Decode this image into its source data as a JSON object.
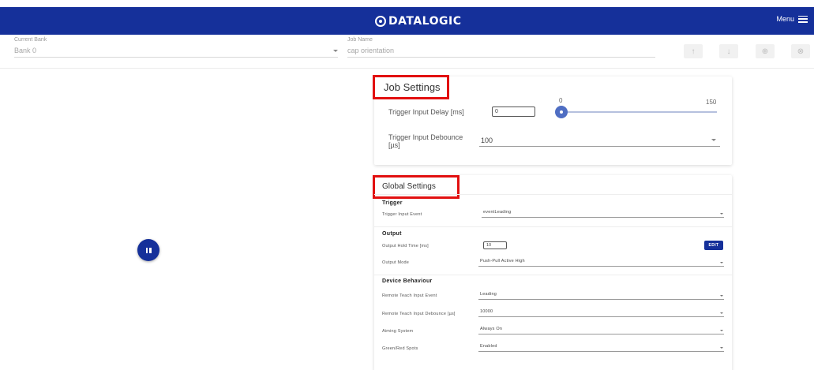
{
  "header": {
    "logo_text": "DATALOGIC",
    "menu_label": "Menu"
  },
  "bank": {
    "label": "Current Bank",
    "value": "Bank 0"
  },
  "job": {
    "label": "Job Name",
    "value": "cap orientation"
  },
  "toolbar": {
    "icons": [
      "arrow-up-icon",
      "arrow-down-icon",
      "add-circle-icon",
      "close-circle-icon"
    ],
    "up": "↑",
    "down": "↓",
    "add": "⊕",
    "remove": "⊗"
  },
  "job_settings": {
    "title": "Job Settings",
    "trigger_delay": {
      "label": "Trigger Input Delay [ms]",
      "value": "0",
      "slider_min": "0",
      "slider_max": "150",
      "slider_fraction": 0.0
    },
    "trigger_debounce": {
      "label": "Trigger Input Debounce [µs]",
      "value": "100"
    }
  },
  "global_settings": {
    "title": "Global Settings",
    "trigger": {
      "heading": "Trigger",
      "input_event_label": "Trigger Input Event",
      "input_event_value": "eventLeading"
    },
    "output": {
      "heading": "Output",
      "hold_time_label": "Output Hold Time [ms]",
      "hold_time_value": "10",
      "edit_label": "EDIT",
      "mode_label": "Output Mode",
      "mode_value": "Push-Pull Active High"
    },
    "device": {
      "heading": "Device Behaviour",
      "teach_event_label": "Remote Teach Input Event",
      "teach_event_value": "Leading",
      "teach_debounce_label": "Remote Teach Input Debounce [µs]",
      "teach_debounce_value": "10000",
      "aiming_label": "Aiming System",
      "aiming_value": "Always On",
      "spots_label": "Green/Red Spots",
      "spots_value": "Enabled"
    }
  },
  "colors": {
    "brand": "#15309a",
    "highlight": "#e21010",
    "slider": "#4f6ec3"
  }
}
